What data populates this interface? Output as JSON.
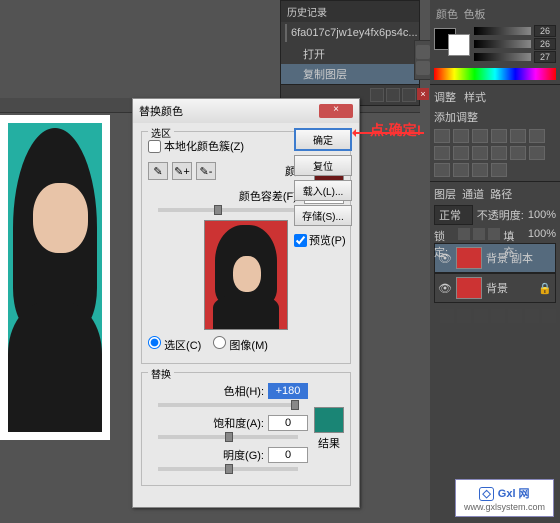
{
  "history": {
    "title": "历史记录",
    "file": "6fa017c7jw1ey4fx6ps4c...",
    "items": [
      "打开",
      "复制图层"
    ]
  },
  "color": {
    "tabs": [
      "颜色",
      "色板"
    ],
    "values": [
      "26",
      "26",
      "27"
    ]
  },
  "adjust": {
    "tabs": [
      "调整",
      "样式"
    ],
    "title": "添加调整"
  },
  "layers": {
    "tabs": [
      "图层",
      "通道",
      "路径"
    ],
    "mode": "正常",
    "opacity_label": "不透明度:",
    "opacity": "100%",
    "lock_label": "锁定:",
    "fill_label": "填充:",
    "fill": "100%",
    "items": [
      "背景 副本",
      "背景"
    ]
  },
  "dialog": {
    "title": "替换颜色",
    "section_selection": "选区",
    "localize": "本地化颜色簇(Z)",
    "color_label": "颜色:",
    "fuzz_label": "颜色容差(F):",
    "fuzz_value": "69",
    "radio_selection": "选区(C)",
    "radio_image": "图像(M)",
    "section_replace": "替换",
    "hue_label": "色相(H):",
    "hue_value": "+180",
    "sat_label": "饱和度(A):",
    "sat_value": "0",
    "light_label": "明度(G):",
    "light_value": "0",
    "result_label": "结果"
  },
  "buttons": {
    "ok": "确定",
    "reset": "复位",
    "load": "载入(L)...",
    "save": "存储(S)...",
    "preview": "预览(P)"
  },
  "callout": "点:确定!",
  "watermark": {
    "name": "Gxl 网",
    "url": "www.gxlsystem.com"
  }
}
